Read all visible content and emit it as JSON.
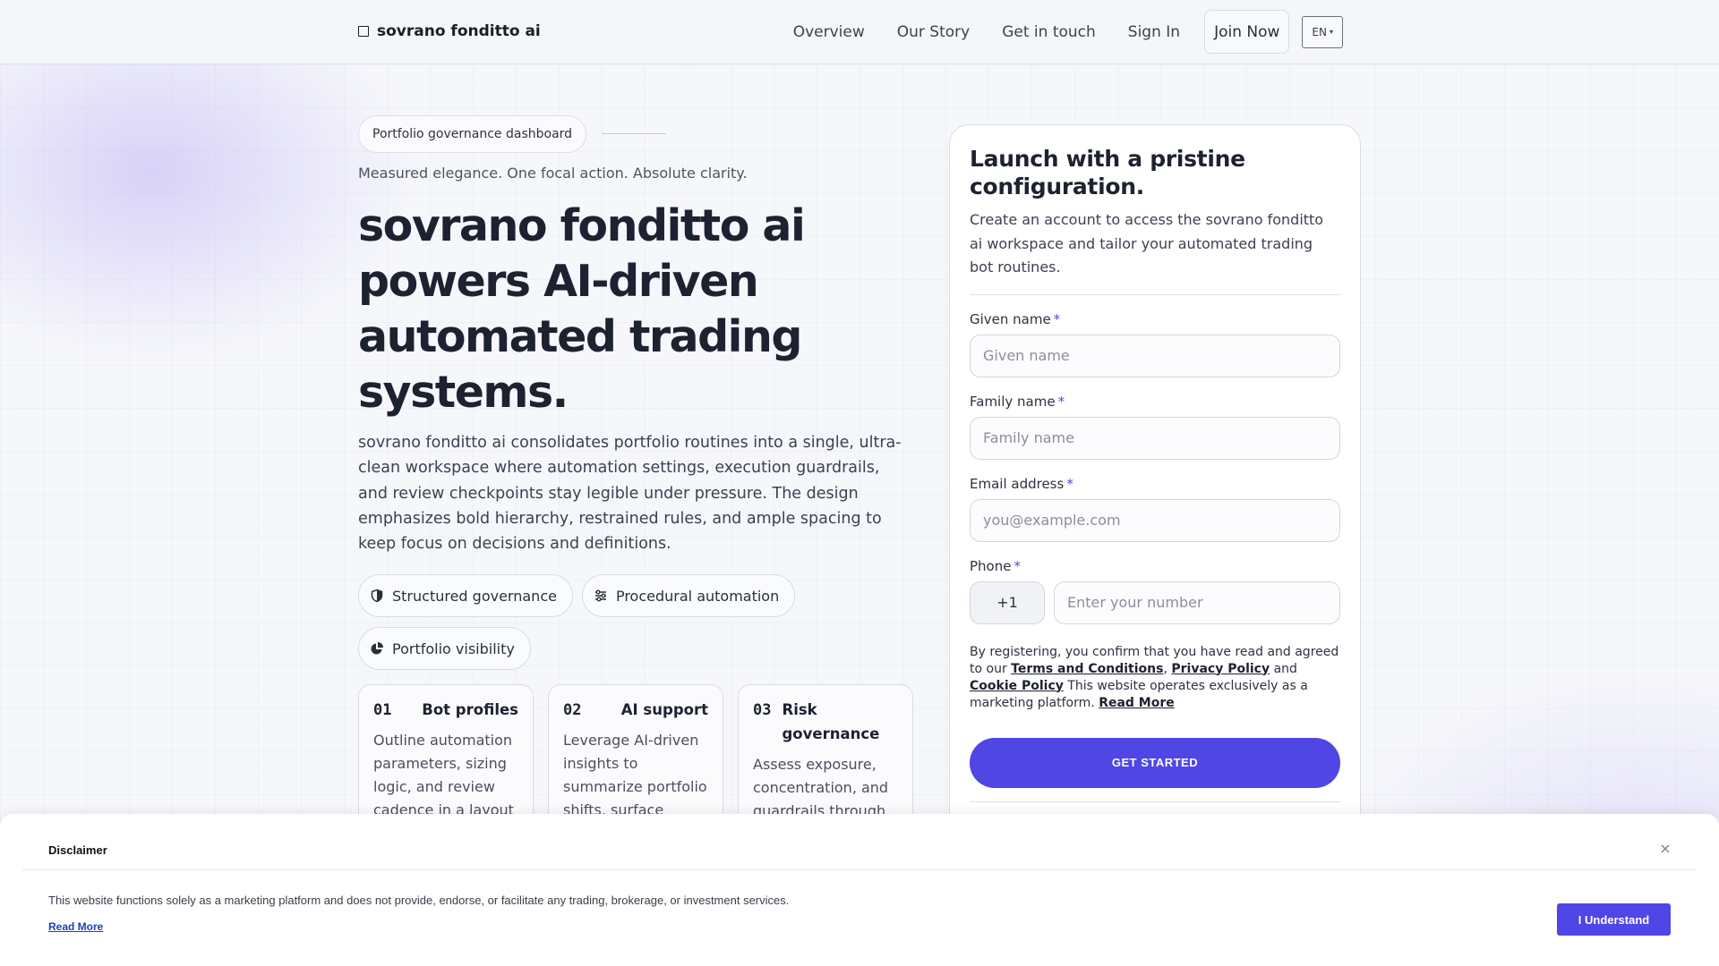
{
  "header": {
    "brand": "sovrano fonditto ai",
    "nav": [
      "Overview",
      "Our Story",
      "Get in touch",
      "Sign In"
    ],
    "join_label": "Join Now",
    "lang_label": "EN"
  },
  "hero": {
    "pill": "Portfolio governance dashboard",
    "tagline": "Measured elegance. One focal action. Absolute clarity.",
    "title": "sovrano fonditto ai powers AI-driven automated trading systems.",
    "description": "sovrano fonditto ai consolidates portfolio routines into a single, ultra-clean workspace where automation settings, execution guardrails, and review checkpoints stay legible under pressure. The design emphasizes bold hierarchy, restrained rules, and ample spacing to keep focus on decisions and definitions.",
    "chips": [
      {
        "label": "Structured governance",
        "icon": "shield-icon"
      },
      {
        "label": "Procedural automation",
        "icon": "sliders-icon"
      },
      {
        "label": "Portfolio visibility",
        "icon": "pie-chart-icon"
      }
    ],
    "cards": [
      {
        "num": "01",
        "title": "Bot profiles",
        "text": "Outline automation parameters, sizing logic, and review cadence in a layout designed for clarity."
      },
      {
        "num": "02",
        "title": "AI support",
        "text": "Leverage AI-driven insights to summarize portfolio shifts, surface constraints and priorities."
      },
      {
        "num": "03",
        "title": "Risk governance",
        "text": "Assess exposure, concentration, and guardrails through structured checkpoints."
      }
    ]
  },
  "form": {
    "title": "Launch with a pristine configuration.",
    "description": "Create an account to access the sovrano fonditto ai workspace and tailor your automated trading bot routines.",
    "given_label": "Given name",
    "given_placeholder": "Given name",
    "family_label": "Family name",
    "family_placeholder": "Family name",
    "email_label": "Email address",
    "email_placeholder": "you@example.com",
    "phone_label": "Phone",
    "required_mark": "*",
    "country_code": "+1",
    "phone_placeholder": "Enter your number",
    "consent_prefix": "By registering, you confirm that you have read and agreed to our",
    "terms": "Terms and Conditions",
    "privacy": "Privacy Policy",
    "and": "and",
    "cookie": "Cookie Policy",
    "consent_suffix": "This website operates exclusively as a marketing platform.",
    "read_more": "Read More",
    "cta": "GET STARTED"
  },
  "disclaimer": {
    "title": "Disclaimer",
    "close": "×",
    "text": "This website functions solely as a marketing platform and does not provide, endorse, or facilitate any trading, brokerage, or investment services.",
    "read_more": "Read More",
    "button": "I Understand"
  },
  "colors": {
    "accent": "#4f46e5",
    "text": "#1d2230"
  }
}
